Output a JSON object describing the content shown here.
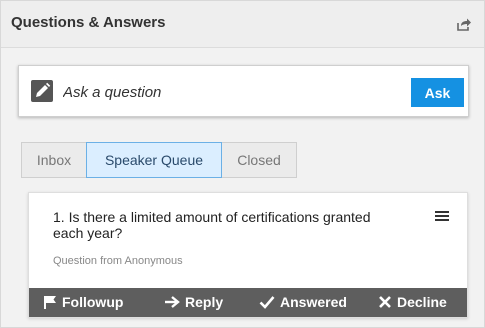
{
  "header": {
    "title": "Questions & Answers",
    "share_icon": "share-icon"
  },
  "ask": {
    "placeholder": "Ask a question",
    "button_label": "Ask",
    "icon": "pencil-icon",
    "accent": "#1591e2"
  },
  "tabs": [
    {
      "label": "Inbox",
      "active": false
    },
    {
      "label": "Speaker Queue",
      "active": true
    },
    {
      "label": "Closed",
      "active": false
    }
  ],
  "questions": [
    {
      "number": "1.",
      "text": "Is there a limited amount of certifications granted each year?",
      "from": "Question from Anonymous",
      "actions": [
        {
          "label": "Followup",
          "icon": "flag-icon"
        },
        {
          "label": "Reply",
          "icon": "arrow-right-icon"
        },
        {
          "label": "Answered",
          "icon": "check-icon"
        },
        {
          "label": "Decline",
          "icon": "x-icon"
        }
      ]
    }
  ]
}
